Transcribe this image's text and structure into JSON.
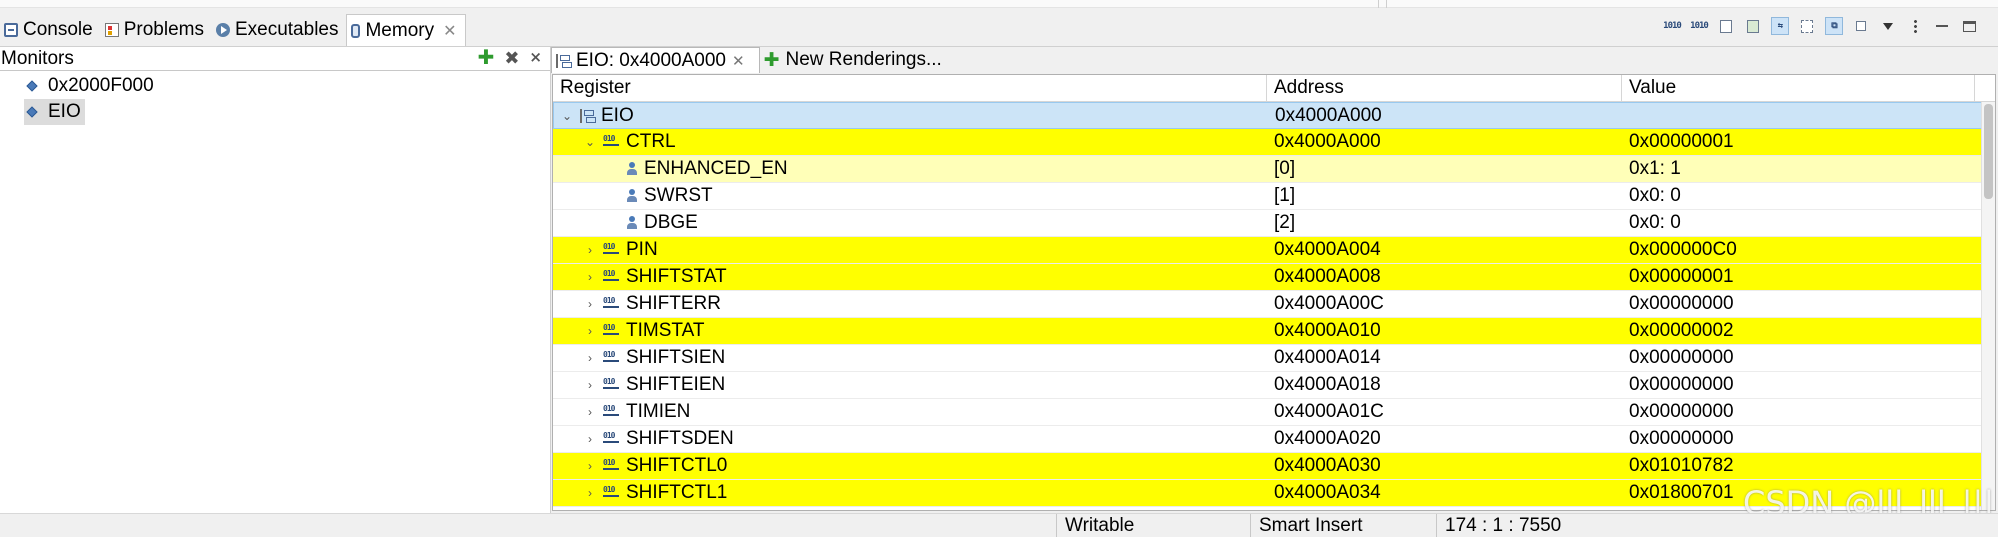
{
  "tabs": [
    {
      "label": "Console",
      "icon": "console-icon"
    },
    {
      "label": "Problems",
      "icon": "problems-icon"
    },
    {
      "label": "Executables",
      "icon": "executables-icon"
    },
    {
      "label": "Memory",
      "icon": "memory-icon",
      "active": true
    }
  ],
  "monitors": {
    "title": "Monitors",
    "items": [
      {
        "label": "0x2000F000"
      },
      {
        "label": "EIO",
        "selected": true
      }
    ]
  },
  "renderings": {
    "tabs": [
      {
        "label": "EIO: 0x4000A000",
        "active": true
      },
      {
        "label": "New Renderings..."
      }
    ],
    "columns": {
      "register": "Register",
      "address": "Address",
      "value": "Value"
    },
    "rows": [
      {
        "name": "EIO",
        "address": "0x4000A000",
        "value": "",
        "level": 0,
        "expand": "open",
        "icon": "peripheral",
        "style": "selected"
      },
      {
        "name": "CTRL",
        "address": "0x4000A000",
        "value": "0x00000001",
        "level": 1,
        "expand": "open",
        "icon": "register",
        "style": "yellow"
      },
      {
        "name": "ENHANCED_EN",
        "address": "[0]",
        "value": "0x1: 1",
        "level": 2,
        "expand": "none",
        "icon": "field",
        "style": "pale"
      },
      {
        "name": "SWRST",
        "address": "[1]",
        "value": "0x0: 0",
        "level": 2,
        "expand": "none",
        "icon": "field",
        "style": "white"
      },
      {
        "name": "DBGE",
        "address": "[2]",
        "value": "0x0: 0",
        "level": 2,
        "expand": "none",
        "icon": "field",
        "style": "white"
      },
      {
        "name": "PIN",
        "address": "0x4000A004",
        "value": "0x000000C0",
        "level": 1,
        "expand": "closed",
        "icon": "register",
        "style": "yellow"
      },
      {
        "name": "SHIFTSTAT",
        "address": "0x4000A008",
        "value": "0x00000001",
        "level": 1,
        "expand": "closed",
        "icon": "register",
        "style": "yellow"
      },
      {
        "name": "SHIFTERR",
        "address": "0x4000A00C",
        "value": "0x00000000",
        "level": 1,
        "expand": "closed",
        "icon": "register",
        "style": "white"
      },
      {
        "name": "TIMSTAT",
        "address": "0x4000A010",
        "value": "0x00000002",
        "level": 1,
        "expand": "closed",
        "icon": "register",
        "style": "yellow"
      },
      {
        "name": "SHIFTSIEN",
        "address": "0x4000A014",
        "value": "0x00000000",
        "level": 1,
        "expand": "closed",
        "icon": "register",
        "style": "white"
      },
      {
        "name": "SHIFTEIEN",
        "address": "0x4000A018",
        "value": "0x00000000",
        "level": 1,
        "expand": "closed",
        "icon": "register",
        "style": "white"
      },
      {
        "name": "TIMIEN",
        "address": "0x4000A01C",
        "value": "0x00000000",
        "level": 1,
        "expand": "closed",
        "icon": "register",
        "style": "white"
      },
      {
        "name": "SHIFTSDEN",
        "address": "0x4000A020",
        "value": "0x00000000",
        "level": 1,
        "expand": "closed",
        "icon": "register",
        "style": "white"
      },
      {
        "name": "SHIFTCTL0",
        "address": "0x4000A030",
        "value": "0x01010782",
        "level": 1,
        "expand": "closed",
        "icon": "register",
        "style": "yellow"
      },
      {
        "name": "SHIFTCTL1",
        "address": "0x4000A034",
        "value": "0x01800701",
        "level": 1,
        "expand": "closed",
        "icon": "register",
        "style": "yellow"
      }
    ]
  },
  "statusbar": {
    "mode": "Writable",
    "insert": "Smart Insert",
    "position": "174 : 1 : 7550"
  },
  "watermark": "CSDN @lll_lll_|||",
  "colors": {
    "highlight": "#ffff00",
    "pale_highlight": "#ffffb8",
    "selection": "#cce4f7"
  }
}
